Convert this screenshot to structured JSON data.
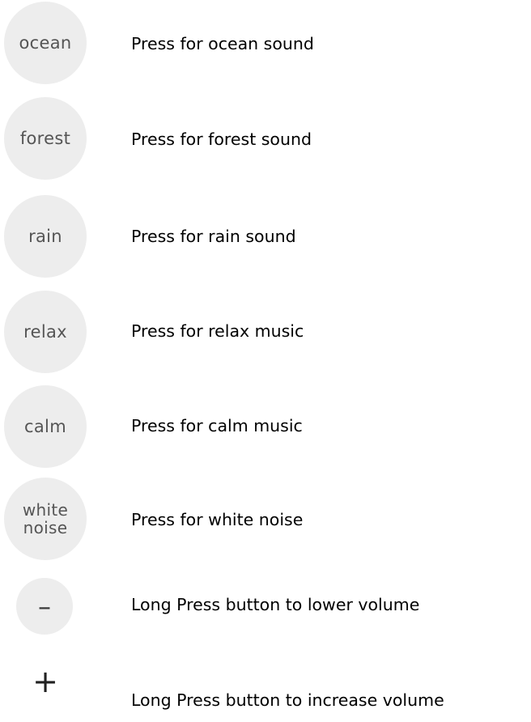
{
  "items": [
    {
      "button_label": "ocean",
      "description": "Press for ocean sound"
    },
    {
      "button_label": "forest",
      "description": "Press for forest sound"
    },
    {
      "button_label": "rain",
      "description": "Press for rain sound"
    },
    {
      "button_label": "relax",
      "description": "Press for relax music"
    },
    {
      "button_label": "calm",
      "description": "Press for calm music"
    },
    {
      "button_label_line1": "white",
      "button_label_line2": "noise",
      "description": "Press for white noise"
    }
  ],
  "volume": {
    "down": {
      "symbol": "–",
      "description": "Long Press button to lower volume"
    },
    "up": {
      "symbol": "+",
      "description": "Long Press button to increase volume"
    }
  },
  "colors": {
    "button_background": "#ededed",
    "button_text": "#555555",
    "description_text": "#000000"
  },
  "icons": {
    "volume_down": "minus-icon",
    "volume_up": "plus-icon"
  }
}
